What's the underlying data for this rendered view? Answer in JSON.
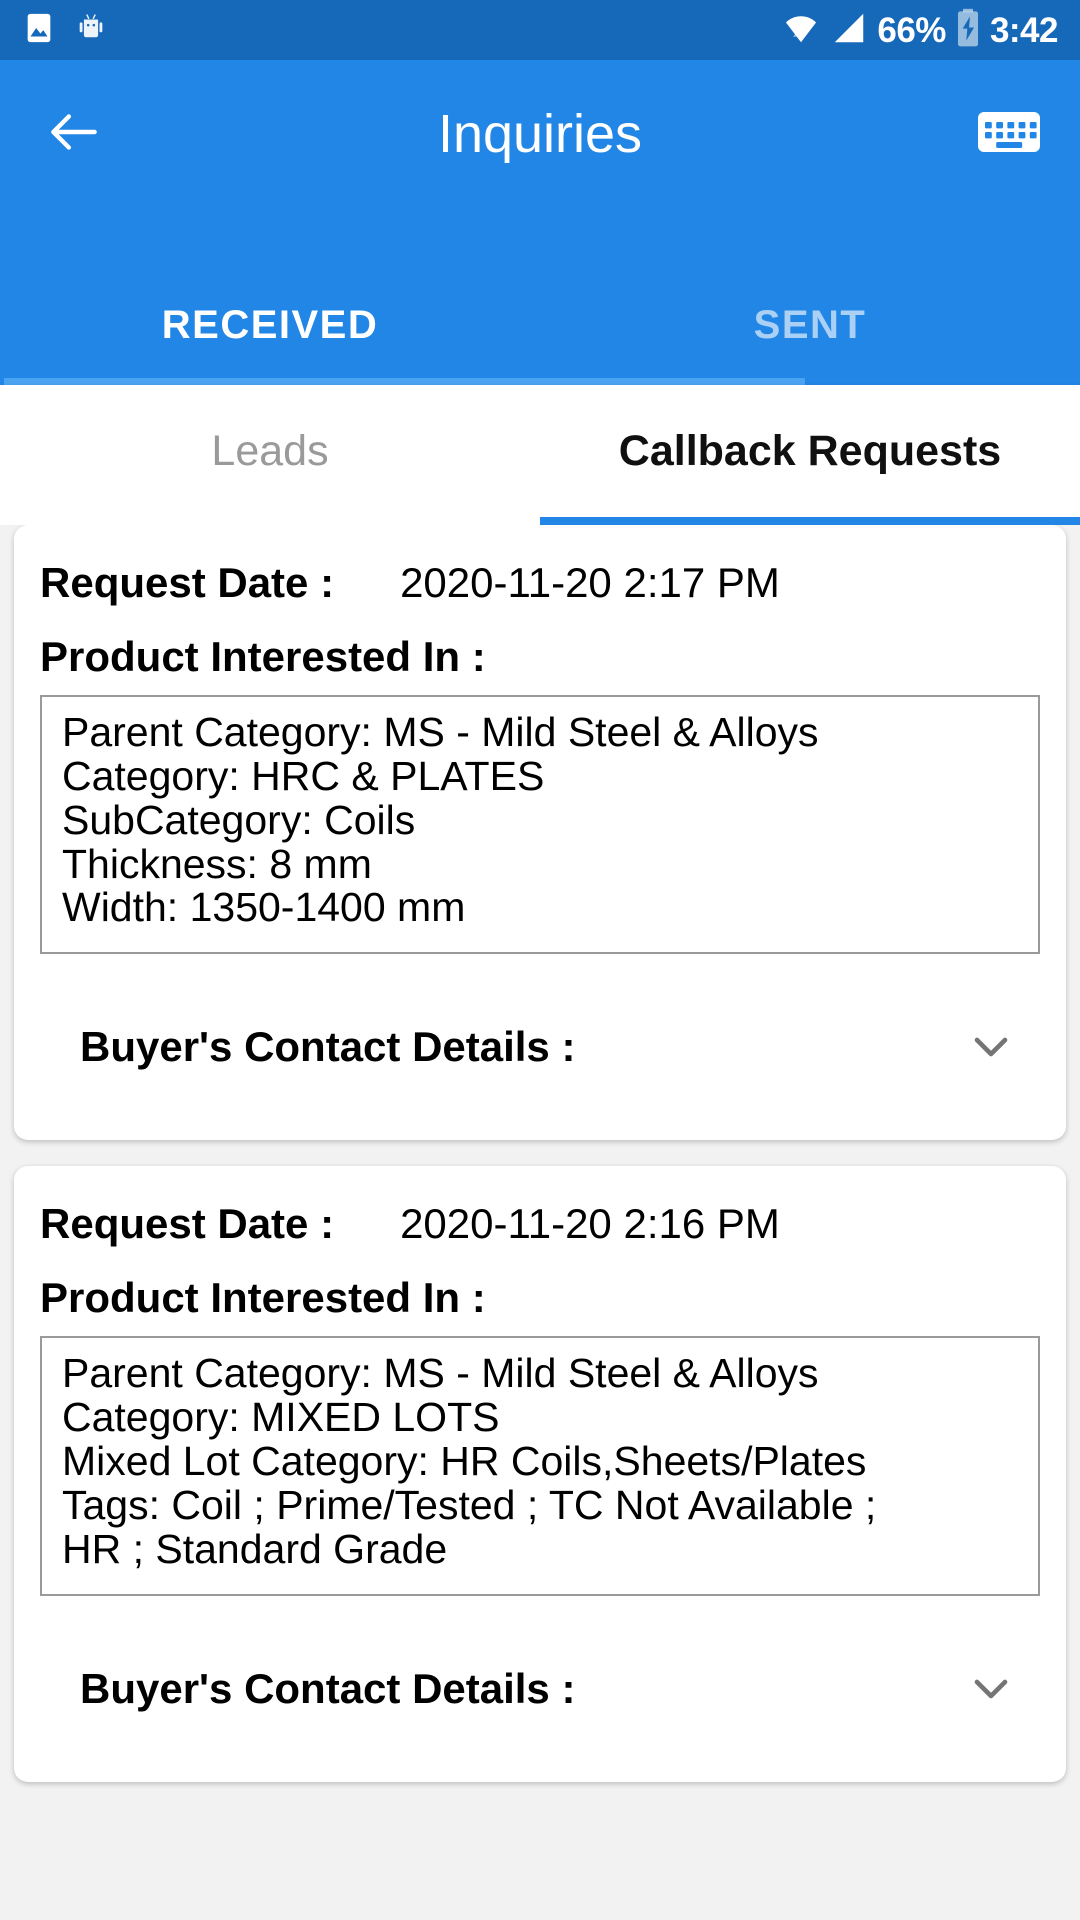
{
  "status_bar": {
    "icons": [
      "image-icon",
      "android-robot-icon",
      "wifi-icon",
      "signal-icon"
    ],
    "battery_percent": "66%",
    "battery_state": "charging",
    "time": "3:42"
  },
  "appbar": {
    "back_icon": "arrow-left-icon",
    "title": "Inquiries",
    "keyboard_icon": "keyboard-icon",
    "background_color": "#2186e5",
    "tabs": [
      {
        "label": "RECEIVED",
        "active": true
      },
      {
        "label": "SENT",
        "active": false
      }
    ]
  },
  "subtabs": [
    {
      "label": "Leads",
      "active": false
    },
    {
      "label": "Callback Requests",
      "active": true
    }
  ],
  "labels": {
    "request_date": "Request Date :",
    "product_interested_in": "Product Interested In :",
    "buyers_contact_details": "Buyer's Contact Details :",
    "expand_icon": "chevron-down-icon"
  },
  "cards": [
    {
      "request_date": "2020-11-20  2:17 PM",
      "product_lines": [
        "Parent Category: MS - Mild Steel & Alloys",
        "Category: HRC & PLATES",
        "SubCategory: Coils",
        "Thickness: 8 mm",
        "Width: 1350-1400 mm"
      ]
    },
    {
      "request_date": "2020-11-20  2:16 PM",
      "product_lines": [
        "Parent Category: MS - Mild Steel & Alloys",
        "Category: MIXED LOTS",
        "Mixed Lot Category: HR Coils,Sheets/Plates",
        "Tags: Coil ; Prime/Tested ; TC Not Available ;",
        "HR ; Standard Grade"
      ]
    }
  ],
  "colors": {
    "status_bar": "#1668b8",
    "primary": "#2186e5",
    "accent_indicator": "#4aa3f0",
    "page_background": "#f2f2f2",
    "card_background": "#ffffff",
    "box_border": "#9a9a9a",
    "inactive_tab_text": "#9a9a9a"
  }
}
